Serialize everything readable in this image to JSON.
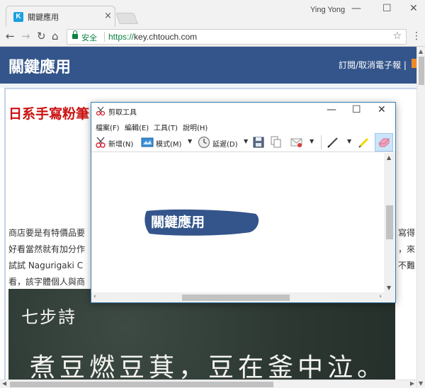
{
  "browser": {
    "tab_title": "關鍵應用",
    "tab_close": "×",
    "favicon_letter": "K",
    "profile_name": "Ying Yong",
    "window_buttons": {
      "minimize": "—",
      "maximize": "☐",
      "close": "✕"
    },
    "nav": {
      "back": "←",
      "forward": "→",
      "reload": "↻",
      "home": "⌂"
    },
    "address_bar": {
      "secure_label": "安全",
      "url_scheme": "https://",
      "url_rest": "key.chtouch.com"
    },
    "star": "☆",
    "menu": "⋮"
  },
  "page": {
    "site_title": "關鍵應用",
    "header_links": "訂閱/取消電子報 |",
    "article_title": "日系手寫粉筆",
    "paragraph_left": [
      "商店要是有特價品要",
      "好看當然就有加分作",
      "試試  Nagurigaki C",
      "看，該字體個人與商"
    ],
    "paragraph_right": [
      "寫得",
      "，來",
      "不難"
    ],
    "chalkboard": {
      "line1": "七步詩",
      "line2": "煮豆燃豆萁，豆在釜中泣。"
    }
  },
  "snipping_tool": {
    "title": "剪取工具",
    "menus": [
      "檔案(F)",
      "編輯(E)",
      "工具(T)",
      "說明(H)"
    ],
    "toolbar": {
      "new_label": "新增(N)",
      "mode_label": "模式(M)",
      "delay_label": "延遲(D)"
    },
    "window_buttons": {
      "minimize": "—",
      "maximize": "☐",
      "close": "✕"
    },
    "clip_text": "關鍵應用"
  },
  "colors": {
    "header_blue": "#34558b",
    "title_red": "#cc1111",
    "secure_green": "#0b8043",
    "snip_border": "#3c7fb1",
    "eraser_active": "#cce4f7"
  }
}
